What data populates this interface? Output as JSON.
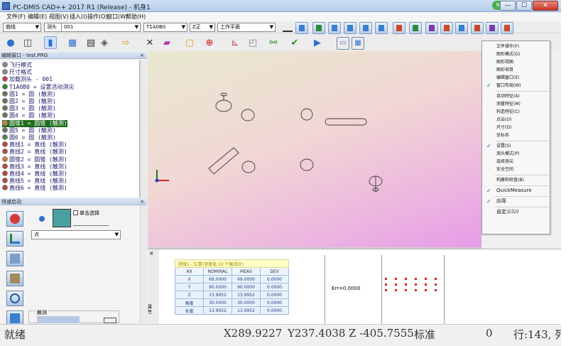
{
  "window": {
    "title": "PC-DMIS CAD++ 2017 R1 (Release) - 机身1",
    "min": "—",
    "max": "☐",
    "close": "✕",
    "user_badge": "88"
  },
  "menubar": {
    "items": [
      "文件(F)",
      "编辑(E)",
      "视图(V)",
      "插入(I)",
      "操作(O)",
      "窗口(W)",
      "帮助(H)"
    ]
  },
  "selectors": {
    "mode": "曲线",
    "probe_file": "测头",
    "tip": "T1A0B0",
    "view": "Z正",
    "workplane": "Z正",
    "plane": "工作平面"
  },
  "panels": {
    "edit_window_title": "编辑窗口 - test.PRG",
    "probe_panel_title": "快速启动",
    "single_click_label": "单击选择",
    "probe_dropdown_value": "点",
    "thumb_label": "触测"
  },
  "tree": [
    {
      "text": "飞行模式",
      "icon": "flight-mode-icon"
    },
    {
      "text": "尺寸格式",
      "icon": "dimension-format-icon"
    },
    {
      "text": "加载测头 - 001",
      "icon": "load-probe-icon"
    },
    {
      "text": "T1A0B0 = 设置活动测尖",
      "icon": "probe-tip-icon"
    },
    {
      "text": "圆1 = 圆 (触测)",
      "icon": "circle-feature-icon"
    },
    {
      "text": "圆2 = 圆 (触测)",
      "icon": "circle-feature-icon"
    },
    {
      "text": "圆3 = 圆 (触测)",
      "icon": "circle-feature-icon"
    },
    {
      "text": "圆4 = 圆 (触测)",
      "icon": "circle-feature-icon"
    },
    {
      "text": "圆锥1 = 圆锥 (触测)",
      "icon": "cone-feature-icon",
      "highlight": true
    },
    {
      "text": "圆5 = 圆 (触测)",
      "icon": "circle-feature-icon"
    },
    {
      "text": "圆6 = 圆 (触测)",
      "icon": "circle-feature-icon"
    },
    {
      "text": "直线1 = 直线 (触测)",
      "icon": "line-feature-icon"
    },
    {
      "text": "直线2 = 直线 (触测)",
      "icon": "line-feature-icon"
    },
    {
      "text": "圆锥2 = 圆锥 (触测)",
      "icon": "cone-feature-icon"
    },
    {
      "text": "直线3 = 直线 (触测)",
      "icon": "line-feature-icon"
    },
    {
      "text": "直线4 = 直线 (触测)",
      "icon": "line-feature-icon"
    },
    {
      "text": "直线5 = 直线 (触测)",
      "icon": "line-feature-icon"
    },
    {
      "text": "直线6 = 直线 (触测)",
      "icon": "line-feature-icon"
    }
  ],
  "context_menu": {
    "items": [
      {
        "label": "文件操作(F)",
        "checked": false
      },
      {
        "label": "图形模式(G)",
        "checked": false
      },
      {
        "label": "图形视图",
        "checked": false
      },
      {
        "label": "图形项目",
        "checked": false
      },
      {
        "label": "编辑窗口(E)",
        "checked": false
      },
      {
        "label": "窗口布局(W)",
        "checked": true
      },
      {
        "label": "自动特征(A)",
        "checked": false
      },
      {
        "label": "测量特征(M)",
        "checked": false
      },
      {
        "label": "构造特征(C)",
        "checked": false
      },
      {
        "label": "点云(O)",
        "checked": false
      },
      {
        "label": "尺寸(D)",
        "checked": false
      },
      {
        "label": "坐标系",
        "checked": false
      },
      {
        "label": "设置(S)",
        "checked": true
      },
      {
        "label": "测头模式(P)",
        "checked": false
      },
      {
        "label": "选择测尖",
        "checked": false
      },
      {
        "label": "安全空间",
        "checked": false
      },
      {
        "label": "构建和检查(B)",
        "checked": false
      },
      {
        "label": "QuickMeasure",
        "checked": true
      },
      {
        "label": "向导",
        "checked": true
      },
      {
        "label": "自定义(U)",
        "checked": false
      }
    ]
  },
  "report": {
    "caption": "圆锥1 - 位置(测量值 10 个触测点)",
    "headers": [
      "AX",
      "NOMINAL",
      "MEAS",
      "DEV"
    ],
    "rows": [
      [
        "X",
        "69.0000",
        "69.0000",
        "0.0000"
      ],
      [
        "Y",
        "90.0000",
        "90.0000",
        "0.0000"
      ],
      [
        "Z",
        "13.9952",
        "13.9952",
        "0.0000"
      ],
      [
        "角度",
        "30.0000",
        "30.0000",
        "0.0000"
      ],
      [
        "长度",
        "13.9952",
        "13.9952",
        "0.0000"
      ]
    ],
    "err_text": "Err=0.0000",
    "side_tab": "属性"
  },
  "status": {
    "state": "就绪",
    "x": "X289.9227",
    "y": "Y237.4038",
    "z": "Z -405.7555",
    "unit": "标准",
    "count": "0",
    "line": "行:143, 列"
  },
  "colors": {
    "highlight_row": "#1e6b1e",
    "viewport_top": "#e8e8d0",
    "viewport_bottom": "#e59be7",
    "error_dot": "#e02020",
    "axis_y": "#1a7a1a",
    "axis_x": "#d42020",
    "axis_z": "#1a3fd0"
  }
}
